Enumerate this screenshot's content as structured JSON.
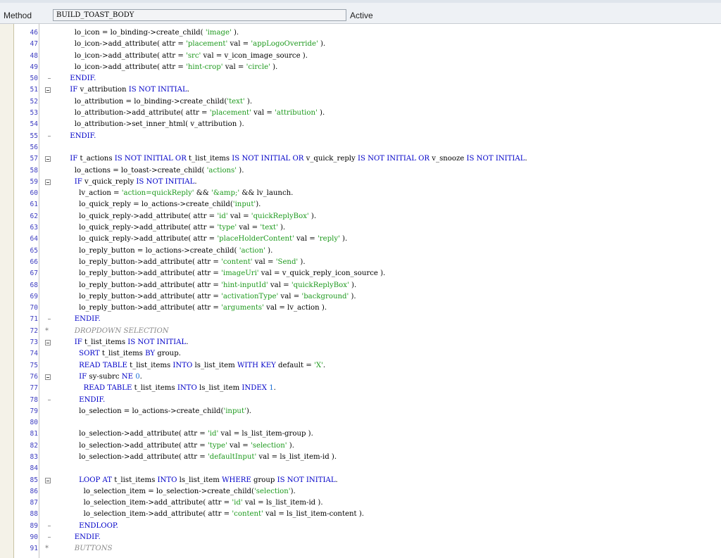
{
  "header": {
    "method_label": "Method",
    "method_name": "BUILD_TOAST_BODY",
    "status": "Active"
  },
  "editor": {
    "lines": [
      {
        "n": "46",
        "m": "",
        "t": [
          [
            "",
            "        lo_icon = lo_binding->create_child( "
          ],
          [
            "str",
            "'image'"
          ],
          [
            "",
            " )."
          ]
        ]
      },
      {
        "n": "47",
        "m": "",
        "t": [
          [
            "",
            "        lo_icon->add_attribute( attr = "
          ],
          [
            "str",
            "'placement'"
          ],
          [
            "",
            " val = "
          ],
          [
            "str",
            "'appLogoOverride'"
          ],
          [
            "",
            " )."
          ]
        ]
      },
      {
        "n": "48",
        "m": "",
        "t": [
          [
            "",
            "        lo_icon->add_attribute( attr = "
          ],
          [
            "str",
            "'src'"
          ],
          [
            "",
            " val = v_icon_image_source )."
          ]
        ]
      },
      {
        "n": "49",
        "m": "",
        "t": [
          [
            "",
            "        lo_icon->add_attribute( attr = "
          ],
          [
            "str",
            "'hint-crop'"
          ],
          [
            "",
            " val = "
          ],
          [
            "str",
            "'circle'"
          ],
          [
            "",
            " )."
          ]
        ]
      },
      {
        "n": "50",
        "m": "end",
        "t": [
          [
            "kw",
            "      ENDIF."
          ]
        ]
      },
      {
        "n": "51",
        "m": "fold",
        "t": [
          [
            "kw",
            "      IF"
          ],
          [
            "",
            " v_attribution "
          ],
          [
            "kw",
            "IS NOT INITIAL"
          ],
          [
            "",
            "."
          ]
        ]
      },
      {
        "n": "52",
        "m": "",
        "t": [
          [
            "",
            "        lo_attribution = lo_binding->create_child("
          ],
          [
            "str",
            "'text'"
          ],
          [
            "",
            " )."
          ]
        ]
      },
      {
        "n": "53",
        "m": "",
        "t": [
          [
            "",
            "        lo_attribution->add_attribute( attr = "
          ],
          [
            "str",
            "'placement'"
          ],
          [
            "",
            " val = "
          ],
          [
            "str",
            "'attribution'"
          ],
          [
            "",
            " )."
          ]
        ]
      },
      {
        "n": "54",
        "m": "",
        "t": [
          [
            "",
            "        lo_attribution->set_inner_html( v_attribution )."
          ]
        ]
      },
      {
        "n": "55",
        "m": "end",
        "t": [
          [
            "kw",
            "      ENDIF."
          ]
        ]
      },
      {
        "n": "56",
        "m": "",
        "t": []
      },
      {
        "n": "57",
        "m": "fold",
        "t": [
          [
            "kw",
            "      IF"
          ],
          [
            "",
            " t_actions "
          ],
          [
            "kw",
            "IS NOT INITIAL OR"
          ],
          [
            "",
            " t_list_items "
          ],
          [
            "kw",
            "IS NOT INITIAL OR"
          ],
          [
            "",
            " v_quick_reply "
          ],
          [
            "kw",
            "IS NOT INITIAL OR"
          ],
          [
            "",
            " v_snooze "
          ],
          [
            "kw",
            "IS NOT INITIAL"
          ],
          [
            "",
            "."
          ]
        ]
      },
      {
        "n": "58",
        "m": "",
        "t": [
          [
            "",
            "        lo_actions = lo_toast->create_child( "
          ],
          [
            "str",
            "'actions'"
          ],
          [
            "",
            " )."
          ]
        ]
      },
      {
        "n": "59",
        "m": "fold",
        "t": [
          [
            "kw",
            "        IF"
          ],
          [
            "",
            " v_quick_reply "
          ],
          [
            "kw",
            "IS NOT INITIAL"
          ],
          [
            "",
            "."
          ]
        ]
      },
      {
        "n": "60",
        "m": "",
        "t": [
          [
            "",
            "          lv_action = "
          ],
          [
            "str",
            "'action=quickReply'"
          ],
          [
            "",
            " && "
          ],
          [
            "str",
            "'&amp;'"
          ],
          [
            "",
            " && lv_launch."
          ]
        ]
      },
      {
        "n": "61",
        "m": "",
        "t": [
          [
            "",
            "          lo_quick_reply = lo_actions->create_child("
          ],
          [
            "str",
            "'input'"
          ],
          [
            "",
            ")."
          ]
        ]
      },
      {
        "n": "62",
        "m": "",
        "t": [
          [
            "",
            "          lo_quick_reply->add_attribute( attr = "
          ],
          [
            "str",
            "'id'"
          ],
          [
            "",
            " val = "
          ],
          [
            "str",
            "'quickReplyBox'"
          ],
          [
            "",
            " )."
          ]
        ]
      },
      {
        "n": "63",
        "m": "",
        "t": [
          [
            "",
            "          lo_quick_reply->add_attribute( attr = "
          ],
          [
            "str",
            "'type'"
          ],
          [
            "",
            " val = "
          ],
          [
            "str",
            "'text'"
          ],
          [
            "",
            " )."
          ]
        ]
      },
      {
        "n": "64",
        "m": "",
        "t": [
          [
            "",
            "          lo_quick_reply->add_attribute( attr = "
          ],
          [
            "str",
            "'placeHolderContent'"
          ],
          [
            "",
            " val = "
          ],
          [
            "str",
            "'reply'"
          ],
          [
            "",
            " )."
          ]
        ]
      },
      {
        "n": "65",
        "m": "",
        "t": [
          [
            "",
            "          lo_reply_button = lo_actions->create_child( "
          ],
          [
            "str",
            "'action'"
          ],
          [
            "",
            " )."
          ]
        ]
      },
      {
        "n": "66",
        "m": "",
        "t": [
          [
            "",
            "          lo_reply_button->add_attribute( attr = "
          ],
          [
            "str",
            "'content'"
          ],
          [
            "",
            " val = "
          ],
          [
            "str",
            "'Send'"
          ],
          [
            "",
            " )."
          ]
        ]
      },
      {
        "n": "67",
        "m": "",
        "t": [
          [
            "",
            "          lo_reply_button->add_attribute( attr = "
          ],
          [
            "str",
            "'imageUri'"
          ],
          [
            "",
            " val = v_quick_reply_icon_source )."
          ]
        ]
      },
      {
        "n": "68",
        "m": "",
        "t": [
          [
            "",
            "          lo_reply_button->add_attribute( attr = "
          ],
          [
            "str",
            "'hint-inputId'"
          ],
          [
            "",
            " val = "
          ],
          [
            "str",
            "'quickReplyBox'"
          ],
          [
            "",
            " )."
          ]
        ]
      },
      {
        "n": "69",
        "m": "",
        "t": [
          [
            "",
            "          lo_reply_button->add_attribute( attr = "
          ],
          [
            "str",
            "'activationType'"
          ],
          [
            "",
            " val = "
          ],
          [
            "str",
            "'background'"
          ],
          [
            "",
            " )."
          ]
        ]
      },
      {
        "n": "70",
        "m": "",
        "t": [
          [
            "",
            "          lo_reply_button->add_attribute( attr = "
          ],
          [
            "str",
            "'arguments'"
          ],
          [
            "",
            " val = lv_action )."
          ]
        ]
      },
      {
        "n": "71",
        "m": "end",
        "t": [
          [
            "kw",
            "        ENDIF."
          ]
        ]
      },
      {
        "n": "72",
        "m": "cmt",
        "t": [
          [
            "cmt",
            "        DROPDOWN SELECTION"
          ]
        ]
      },
      {
        "n": "73",
        "m": "fold",
        "t": [
          [
            "kw",
            "        IF"
          ],
          [
            "",
            " t_list_items "
          ],
          [
            "kw",
            "IS NOT INITIAL"
          ],
          [
            "",
            "."
          ]
        ]
      },
      {
        "n": "74",
        "m": "",
        "t": [
          [
            "kw",
            "          SORT"
          ],
          [
            "",
            " t_list_items "
          ],
          [
            "kw",
            "BY"
          ],
          [
            "",
            " group."
          ]
        ]
      },
      {
        "n": "75",
        "m": "",
        "t": [
          [
            "kw",
            "          READ TABLE"
          ],
          [
            "",
            " t_list_items "
          ],
          [
            "kw",
            "INTO"
          ],
          [
            "",
            " ls_list_item "
          ],
          [
            "kw",
            "WITH KEY"
          ],
          [
            "",
            " default = "
          ],
          [
            "str",
            "'X'"
          ],
          [
            "",
            "."
          ]
        ]
      },
      {
        "n": "76",
        "m": "fold",
        "t": [
          [
            "kw",
            "          IF"
          ],
          [
            "",
            " sy-subrc "
          ],
          [
            "kw",
            "NE"
          ],
          [
            " ",
            " "
          ],
          [
            "num",
            "0"
          ],
          [
            "",
            "."
          ]
        ]
      },
      {
        "n": "77",
        "m": "",
        "t": [
          [
            "kw",
            "            READ TABLE"
          ],
          [
            "",
            " t_list_items "
          ],
          [
            "kw",
            "INTO"
          ],
          [
            "",
            " ls_list_item "
          ],
          [
            "kw",
            "INDEX"
          ],
          [
            "",
            " "
          ],
          [
            "num",
            "1"
          ],
          [
            "",
            "."
          ]
        ]
      },
      {
        "n": "78",
        "m": "end",
        "t": [
          [
            "kw",
            "          ENDIF."
          ]
        ]
      },
      {
        "n": "79",
        "m": "",
        "t": [
          [
            "",
            "          lo_selection = lo_actions->create_child("
          ],
          [
            "str",
            "'input'"
          ],
          [
            "",
            ")."
          ]
        ]
      },
      {
        "n": "80",
        "m": "",
        "t": []
      },
      {
        "n": "81",
        "m": "",
        "t": [
          [
            "",
            "          lo_selection->add_attribute( attr = "
          ],
          [
            "str",
            "'id'"
          ],
          [
            "",
            " val = ls_list_item-group )."
          ]
        ]
      },
      {
        "n": "82",
        "m": "",
        "t": [
          [
            "",
            "          lo_selection->add_attribute( attr = "
          ],
          [
            "str",
            "'type'"
          ],
          [
            "",
            " val = "
          ],
          [
            "str",
            "'selection'"
          ],
          [
            "",
            " )."
          ]
        ]
      },
      {
        "n": "83",
        "m": "",
        "t": [
          [
            "",
            "          lo_selection->add_attribute( attr = "
          ],
          [
            "str",
            "'defaultInput'"
          ],
          [
            "",
            " val = ls_list_item-id )."
          ]
        ]
      },
      {
        "n": "84",
        "m": "",
        "t": []
      },
      {
        "n": "85",
        "m": "fold",
        "t": [
          [
            "kw",
            "          LOOP AT"
          ],
          [
            "",
            " t_list_items "
          ],
          [
            "kw",
            "INTO"
          ],
          [
            "",
            " ls_list_item "
          ],
          [
            "kw",
            "WHERE"
          ],
          [
            "",
            " group "
          ],
          [
            "kw",
            "IS NOT INITIAL"
          ],
          [
            "",
            "."
          ]
        ]
      },
      {
        "n": "86",
        "m": "",
        "t": [
          [
            "",
            "            lo_selection_item = lo_selection->create_child("
          ],
          [
            "str",
            "'selection'"
          ],
          [
            "",
            ")."
          ]
        ]
      },
      {
        "n": "87",
        "m": "",
        "t": [
          [
            "",
            "            lo_selection_item->add_attribute( attr = "
          ],
          [
            "str",
            "'id'"
          ],
          [
            "",
            " val = ls_list_item-id )."
          ]
        ]
      },
      {
        "n": "88",
        "m": "",
        "t": [
          [
            "",
            "            lo_selection_item->add_attribute( attr = "
          ],
          [
            "str",
            "'content'"
          ],
          [
            "",
            " val = ls_list_item-content )."
          ]
        ]
      },
      {
        "n": "89",
        "m": "end",
        "t": [
          [
            "kw",
            "          ENDLOOP."
          ]
        ]
      },
      {
        "n": "90",
        "m": "end",
        "t": [
          [
            "kw",
            "        ENDIF."
          ]
        ]
      },
      {
        "n": "91",
        "m": "cmt",
        "t": [
          [
            "cmt",
            "        BUTTONS"
          ]
        ]
      }
    ]
  }
}
